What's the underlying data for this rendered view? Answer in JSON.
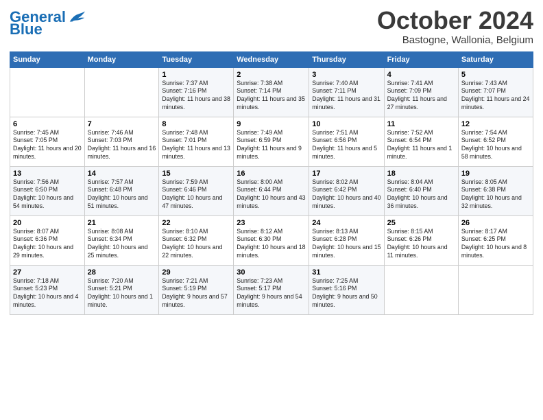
{
  "header": {
    "logo_line1": "General",
    "logo_line2": "Blue",
    "month": "October 2024",
    "location": "Bastogne, Wallonia, Belgium"
  },
  "columns": [
    "Sunday",
    "Monday",
    "Tuesday",
    "Wednesday",
    "Thursday",
    "Friday",
    "Saturday"
  ],
  "rows": [
    [
      {
        "day": "",
        "info": ""
      },
      {
        "day": "",
        "info": ""
      },
      {
        "day": "1",
        "info": "Sunrise: 7:37 AM\nSunset: 7:16 PM\nDaylight: 11 hours and 38 minutes."
      },
      {
        "day": "2",
        "info": "Sunrise: 7:38 AM\nSunset: 7:14 PM\nDaylight: 11 hours and 35 minutes."
      },
      {
        "day": "3",
        "info": "Sunrise: 7:40 AM\nSunset: 7:11 PM\nDaylight: 11 hours and 31 minutes."
      },
      {
        "day": "4",
        "info": "Sunrise: 7:41 AM\nSunset: 7:09 PM\nDaylight: 11 hours and 27 minutes."
      },
      {
        "day": "5",
        "info": "Sunrise: 7:43 AM\nSunset: 7:07 PM\nDaylight: 11 hours and 24 minutes."
      }
    ],
    [
      {
        "day": "6",
        "info": "Sunrise: 7:45 AM\nSunset: 7:05 PM\nDaylight: 11 hours and 20 minutes."
      },
      {
        "day": "7",
        "info": "Sunrise: 7:46 AM\nSunset: 7:03 PM\nDaylight: 11 hours and 16 minutes."
      },
      {
        "day": "8",
        "info": "Sunrise: 7:48 AM\nSunset: 7:01 PM\nDaylight: 11 hours and 13 minutes."
      },
      {
        "day": "9",
        "info": "Sunrise: 7:49 AM\nSunset: 6:59 PM\nDaylight: 11 hours and 9 minutes."
      },
      {
        "day": "10",
        "info": "Sunrise: 7:51 AM\nSunset: 6:56 PM\nDaylight: 11 hours and 5 minutes."
      },
      {
        "day": "11",
        "info": "Sunrise: 7:52 AM\nSunset: 6:54 PM\nDaylight: 11 hours and 1 minute."
      },
      {
        "day": "12",
        "info": "Sunrise: 7:54 AM\nSunset: 6:52 PM\nDaylight: 10 hours and 58 minutes."
      }
    ],
    [
      {
        "day": "13",
        "info": "Sunrise: 7:56 AM\nSunset: 6:50 PM\nDaylight: 10 hours and 54 minutes."
      },
      {
        "day": "14",
        "info": "Sunrise: 7:57 AM\nSunset: 6:48 PM\nDaylight: 10 hours and 51 minutes."
      },
      {
        "day": "15",
        "info": "Sunrise: 7:59 AM\nSunset: 6:46 PM\nDaylight: 10 hours and 47 minutes."
      },
      {
        "day": "16",
        "info": "Sunrise: 8:00 AM\nSunset: 6:44 PM\nDaylight: 10 hours and 43 minutes."
      },
      {
        "day": "17",
        "info": "Sunrise: 8:02 AM\nSunset: 6:42 PM\nDaylight: 10 hours and 40 minutes."
      },
      {
        "day": "18",
        "info": "Sunrise: 8:04 AM\nSunset: 6:40 PM\nDaylight: 10 hours and 36 minutes."
      },
      {
        "day": "19",
        "info": "Sunrise: 8:05 AM\nSunset: 6:38 PM\nDaylight: 10 hours and 32 minutes."
      }
    ],
    [
      {
        "day": "20",
        "info": "Sunrise: 8:07 AM\nSunset: 6:36 PM\nDaylight: 10 hours and 29 minutes."
      },
      {
        "day": "21",
        "info": "Sunrise: 8:08 AM\nSunset: 6:34 PM\nDaylight: 10 hours and 25 minutes."
      },
      {
        "day": "22",
        "info": "Sunrise: 8:10 AM\nSunset: 6:32 PM\nDaylight: 10 hours and 22 minutes."
      },
      {
        "day": "23",
        "info": "Sunrise: 8:12 AM\nSunset: 6:30 PM\nDaylight: 10 hours and 18 minutes."
      },
      {
        "day": "24",
        "info": "Sunrise: 8:13 AM\nSunset: 6:28 PM\nDaylight: 10 hours and 15 minutes."
      },
      {
        "day": "25",
        "info": "Sunrise: 8:15 AM\nSunset: 6:26 PM\nDaylight: 10 hours and 11 minutes."
      },
      {
        "day": "26",
        "info": "Sunrise: 8:17 AM\nSunset: 6:25 PM\nDaylight: 10 hours and 8 minutes."
      }
    ],
    [
      {
        "day": "27",
        "info": "Sunrise: 7:18 AM\nSunset: 5:23 PM\nDaylight: 10 hours and 4 minutes."
      },
      {
        "day": "28",
        "info": "Sunrise: 7:20 AM\nSunset: 5:21 PM\nDaylight: 10 hours and 1 minute."
      },
      {
        "day": "29",
        "info": "Sunrise: 7:21 AM\nSunset: 5:19 PM\nDaylight: 9 hours and 57 minutes."
      },
      {
        "day": "30",
        "info": "Sunrise: 7:23 AM\nSunset: 5:17 PM\nDaylight: 9 hours and 54 minutes."
      },
      {
        "day": "31",
        "info": "Sunrise: 7:25 AM\nSunset: 5:16 PM\nDaylight: 9 hours and 50 minutes."
      },
      {
        "day": "",
        "info": ""
      },
      {
        "day": "",
        "info": ""
      }
    ]
  ]
}
